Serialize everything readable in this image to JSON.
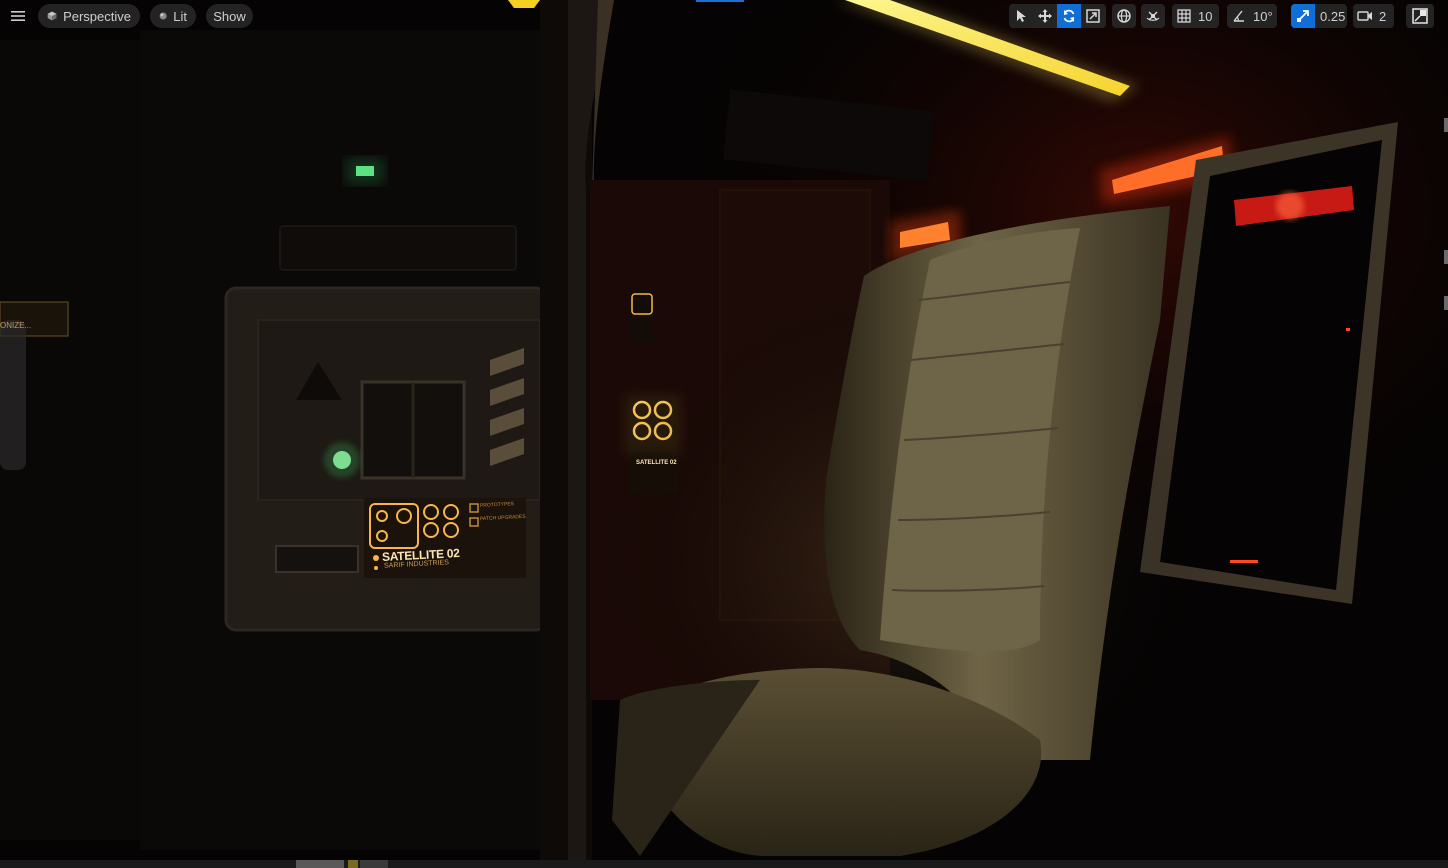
{
  "viewport_toolbar": {
    "menu_icon": "hamburger-icon",
    "perspective_label": "Perspective",
    "lit_label": "Lit",
    "show_label": "Show",
    "grid_snap_value": "10",
    "rotation_snap_value": "10°",
    "scale_snap_value": "0.25",
    "camera_speed_value": "2",
    "accent_color": "#0f6fd6"
  },
  "scene": {
    "wall_panel_text": {
      "title": "SATELLITE 02",
      "subtitle": "SARIF INDUSTRIES",
      "line_a": "PROTOTYPES",
      "line_b": "PATCH UPGRADES"
    },
    "small_panel_text": {
      "title": "SATELLITE 02"
    },
    "left_sign_text": "ONIZE..."
  }
}
